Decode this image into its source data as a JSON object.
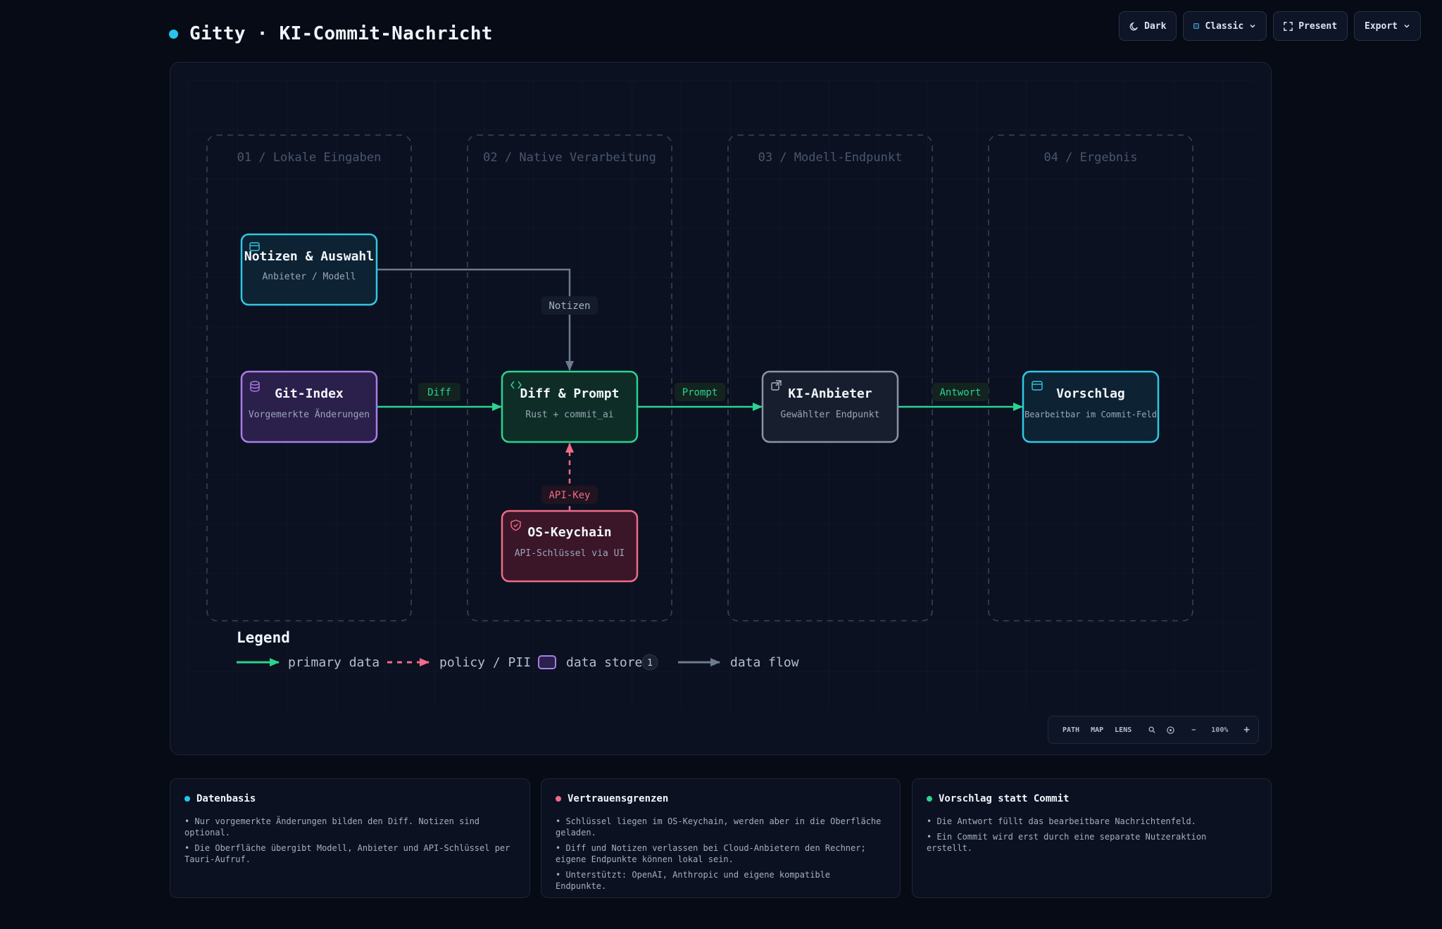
{
  "app": {
    "title": "Gitty · KI-Commit-Nachricht",
    "accent": "#29c3ea"
  },
  "toolbar": {
    "theme_label": "Dark",
    "style_label": "Classic",
    "present_label": "Present",
    "export_label": "Export"
  },
  "diagram": {
    "lanes": [
      {
        "title": "01 / Lokale Eingaben"
      },
      {
        "title": "02 / Native Verarbeitung"
      },
      {
        "title": "03 / Modell-Endpunkt"
      },
      {
        "title": "04 / Ergebnis"
      }
    ],
    "nodes": {
      "notes": {
        "title": "Notizen & Auswahl",
        "subtitle": "Anbieter / Modell",
        "color": "#2fc8e4",
        "icon": "window-icon"
      },
      "git_index": {
        "title": "Git-Index",
        "subtitle": "Vorgemerkte Änderungen",
        "color": "#a87ee8",
        "icon": "database-icon"
      },
      "diff_prompt": {
        "title": "Diff & Prompt",
        "subtitle": "Rust + commit_ai",
        "color": "#2bd38f",
        "icon": "code-icon"
      },
      "ai_provider": {
        "title": "KI-Anbieter",
        "subtitle": "Gewählter Endpunkt",
        "color": "#8a94a6",
        "icon": "external-link-icon"
      },
      "suggestion": {
        "title": "Vorschlag",
        "subtitle": "Bearbeitbar im Commit-Feld",
        "color": "#2fc8e4",
        "icon": "window-icon"
      },
      "keychain": {
        "title": "OS-Keychain",
        "subtitle": "API-Schlüssel via UI",
        "color": "#f06b86",
        "icon": "shield-icon"
      }
    },
    "edges": {
      "notes_to_diff": {
        "label": "Notizen",
        "color": "#6e7a8e"
      },
      "index_to_diff": {
        "label": "Diff",
        "color": "#2bd38f"
      },
      "diff_to_ai": {
        "label": "Prompt",
        "color": "#2bd38f"
      },
      "ai_to_suggestion": {
        "label": "Antwort",
        "color": "#2bd38f"
      },
      "keychain_to_diff": {
        "label": "API-Key",
        "color": "#f06b86"
      }
    },
    "legend": {
      "title": "Legend",
      "primary": "primary data",
      "policy": "policy / PII",
      "store": "data store",
      "store_count": "1",
      "flow": "data flow"
    }
  },
  "zoom": {
    "path": "PATH",
    "map": "MAP",
    "lens": "LENS",
    "level": "100%",
    "minus": "−",
    "plus": "+"
  },
  "cards": [
    {
      "title": "Datenbasis",
      "color": "#29c3ea",
      "items": [
        "Nur vorgemerkte Änderungen bilden den Diff. Notizen sind optional.",
        "Die Oberfläche übergibt Modell, Anbieter und API-Schlüssel per Tauri-Aufruf."
      ]
    },
    {
      "title": "Vertrauensgrenzen",
      "color": "#f06b86",
      "items": [
        "Schlüssel liegen im OS-Keychain, werden aber in die Oberfläche geladen.",
        "Diff und Notizen verlassen bei Cloud-Anbietern den Rechner; eigene Endpunkte können lokal sein.",
        "Unterstützt: OpenAI, Anthropic und eigene kompatible Endpunkte."
      ]
    },
    {
      "title": "Vorschlag statt Commit",
      "color": "#2bd38f",
      "items": [
        "Die Antwort füllt das bearbeitbare Nachrichtenfeld.",
        "Ein Commit wird erst durch eine separate Nutzeraktion erstellt."
      ]
    }
  ]
}
